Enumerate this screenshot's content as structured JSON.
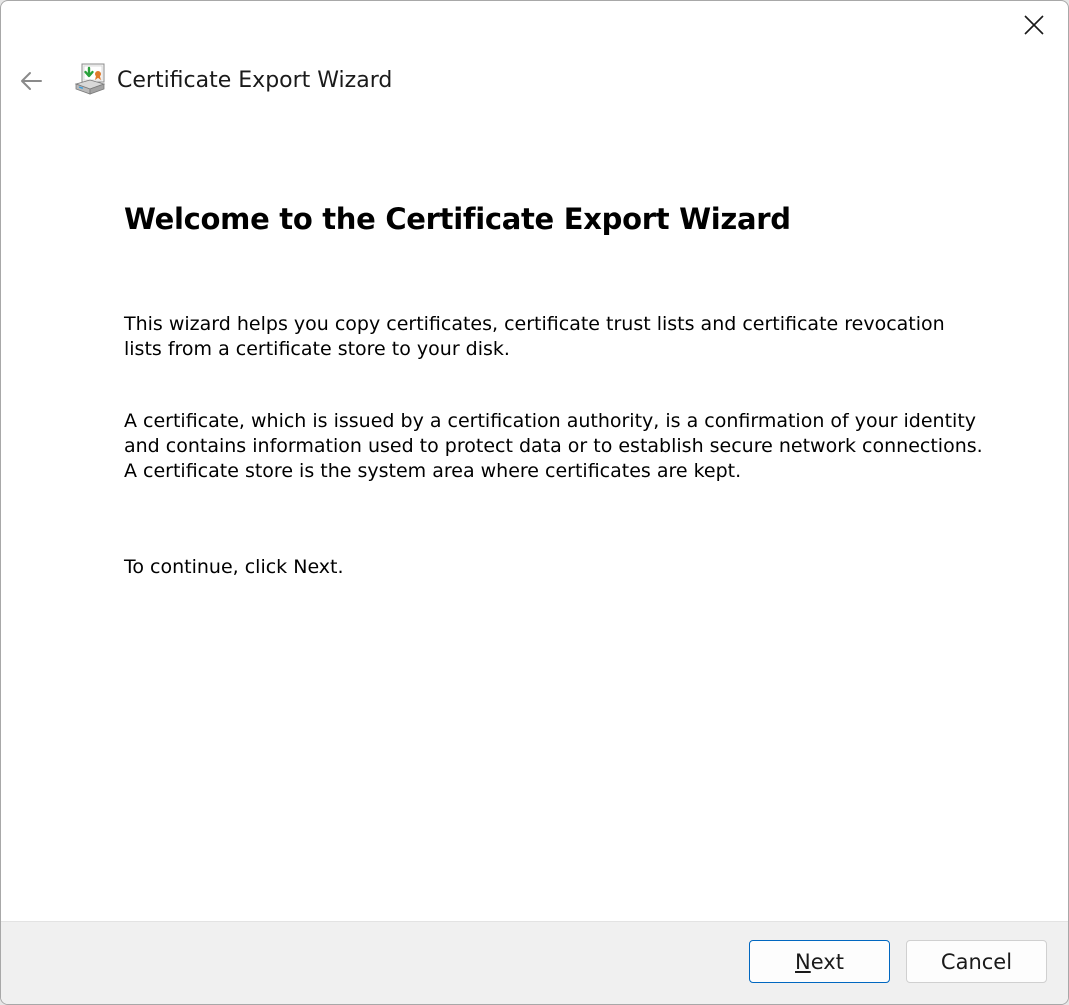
{
  "window": {
    "close_icon": "close-icon"
  },
  "header": {
    "back_icon": "back-arrow-icon",
    "wizard_icon": "certificate-export-icon",
    "title": "Certificate Export Wizard"
  },
  "main": {
    "heading": "Welcome to the Certificate Export Wizard",
    "paragraph1": "This wizard helps you copy certificates, certificate trust lists and certificate revocation lists from a certificate store to your disk.",
    "paragraph2": "A certificate, which is issued by a certification authority, is a confirmation of your identity and contains information used to protect data or to establish secure network connections. A certificate store is the system area where certificates are kept.",
    "paragraph3": "To continue, click Next."
  },
  "footer": {
    "next_mnemonic": "N",
    "next_rest": "ext",
    "cancel_label": "Cancel"
  },
  "colors": {
    "accent": "#0067c0",
    "footer_bg": "#f0f0f0"
  }
}
